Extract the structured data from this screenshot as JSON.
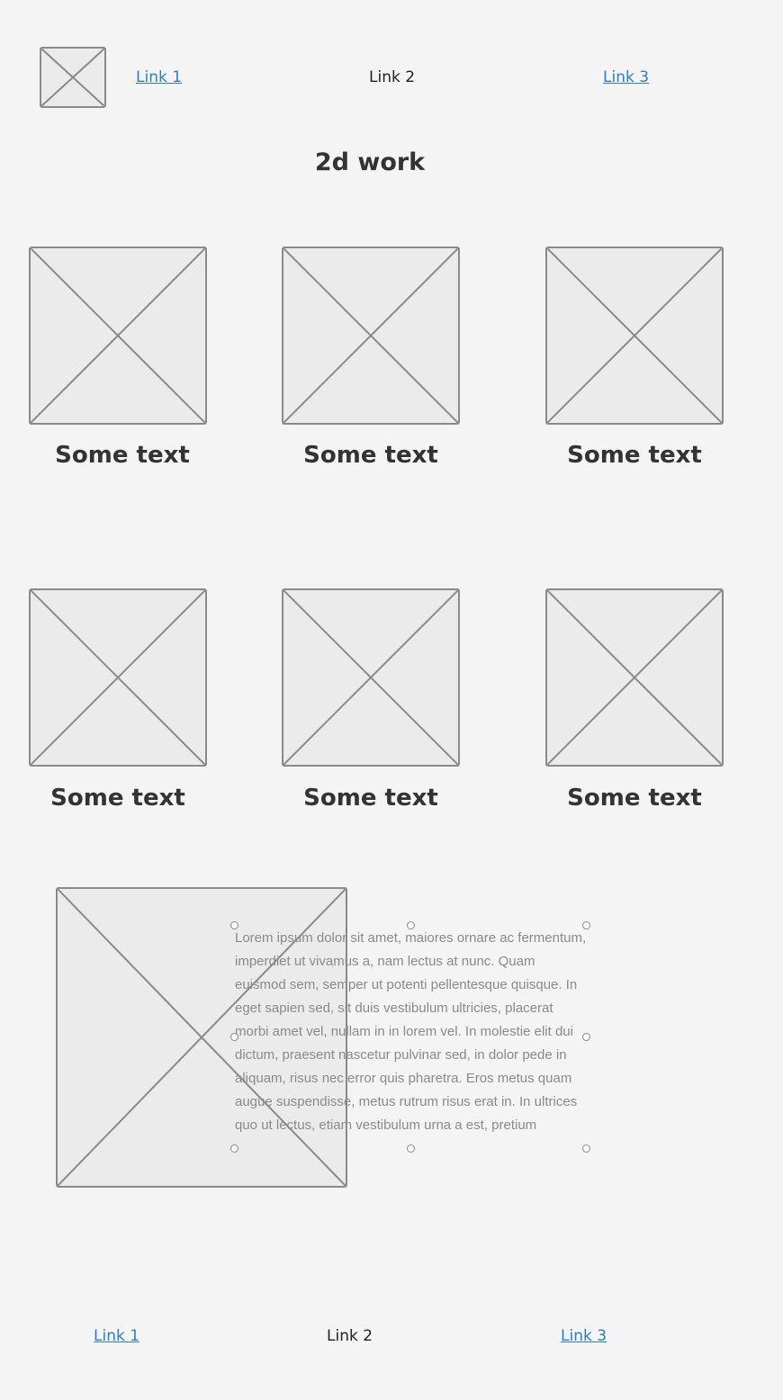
{
  "header": {
    "nav": [
      {
        "label": "Link 1",
        "style": "link"
      },
      {
        "label": "Link 2",
        "style": "plain"
      },
      {
        "label": "Link 3",
        "style": "link"
      }
    ]
  },
  "page": {
    "title": "2d work"
  },
  "gallery": {
    "items": [
      {
        "caption": "Some text"
      },
      {
        "caption": "Some text"
      },
      {
        "caption": "Some text"
      },
      {
        "caption": "Some text"
      },
      {
        "caption": "Some text"
      },
      {
        "caption": "Some text"
      }
    ]
  },
  "feature": {
    "body": "Lorem ipsum dolor sit amet, maiores ornare ac fermentum, imperdiet ut vivamus a, nam lectus at nunc. Quam euismod sem, semper ut potenti pellentesque quisque. In eget sapien sed, sit duis vestibulum ultricies, placerat morbi amet vel, nullam in in lorem vel. In molestie elit dui dictum, praesent nascetur pulvinar sed, in dolor pede in aliquam, risus nec error quis pharetra. Eros metus quam augue suspendisse, metus rutrum risus erat in.  In ultrices quo ut lectus, etiam vestibulum urna a est, pretium"
  },
  "footer": {
    "nav": [
      {
        "label": "Link 1",
        "style": "link"
      },
      {
        "label": "Link 2",
        "style": "plain"
      },
      {
        "label": "Link 3",
        "style": "link"
      }
    ]
  },
  "colors": {
    "background": "#f4f4f4",
    "link": "#2a7fcf",
    "placeholder_fill": "#ebebeb",
    "placeholder_stroke": "#8a8a8a"
  },
  "icons": {
    "placeholder": "image-placeholder-icon",
    "selection_handle": "resize-handle-icon"
  }
}
